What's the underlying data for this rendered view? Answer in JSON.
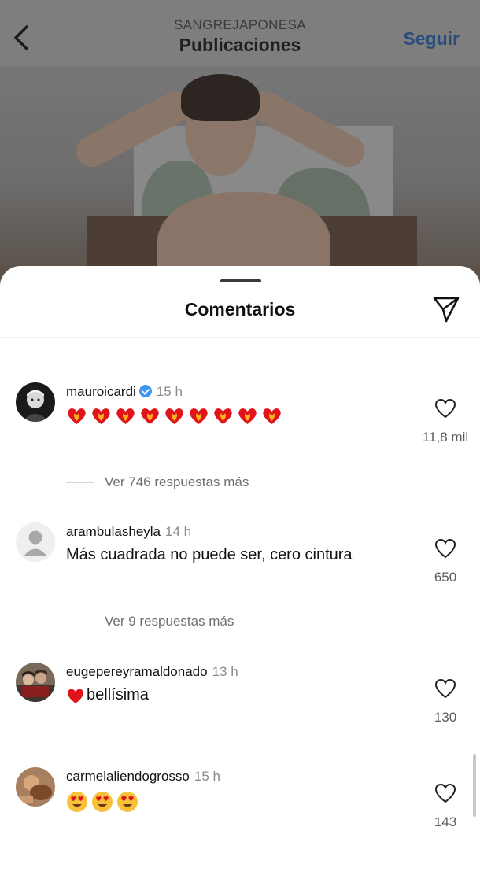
{
  "header": {
    "account": "SANGREJAPONESA",
    "title": "Publicaciones",
    "follow_label": "Seguir"
  },
  "sheet": {
    "title": "Comentarios"
  },
  "comments": [
    {
      "username": "mauroicardi",
      "verified": true,
      "time": "15 h",
      "text": "",
      "emoji": "❤️‍🔥 x9",
      "likes": "11,8 mil",
      "replies_label": "Ver 746 respuestas más"
    },
    {
      "username": "arambulasheyla",
      "verified": false,
      "time": "14 h",
      "text": "Más cuadrada no puede ser, cero cintura",
      "likes": "650",
      "replies_label": "Ver 9 respuestas más"
    },
    {
      "username": "eugepereyramaldonado",
      "verified": false,
      "time": "13 h",
      "text": "bellísima",
      "emoji": "❤️",
      "likes": "130"
    },
    {
      "username": "carmelaliendogrosso",
      "verified": false,
      "time": "15 h",
      "text": "",
      "emoji": "😍😍😍",
      "likes": "143"
    }
  ],
  "icons": {
    "back": "chevron-left-icon",
    "send": "paper-plane-icon",
    "like": "heart-outline-icon",
    "verified": "verified-badge-icon"
  },
  "colors": {
    "follow": "#2a4d7e",
    "verified": "#3c97f3",
    "heart": "#e0151b"
  }
}
